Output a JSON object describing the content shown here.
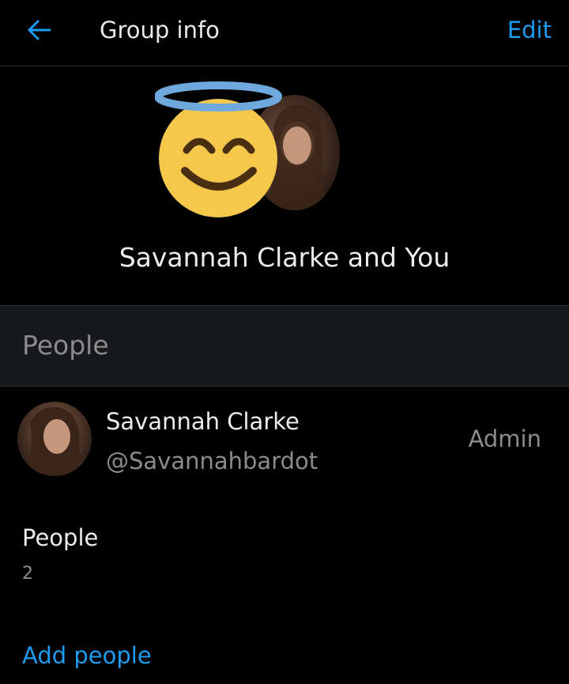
{
  "header": {
    "title": "Group info",
    "edit_label": "Edit",
    "back_icon": "arrow-left-icon"
  },
  "group": {
    "name": "Savannah Clarke and You",
    "emoji_icon": "smiling-face-with-halo-icon"
  },
  "people_section": {
    "title": "People"
  },
  "members": [
    {
      "name": "Savannah Clarke",
      "handle": "@Savannahbardot",
      "role": "Admin"
    }
  ],
  "people_summary": {
    "label": "People",
    "count": "2"
  },
  "actions": {
    "add_people_label": "Add people"
  },
  "colors": {
    "accent": "#1d9bf0",
    "background": "#000000",
    "section_background": "#16181c",
    "secondary_text": "#8b8b8b",
    "halo": "#6ea8dc",
    "emoji_face": "#f5c84c"
  }
}
